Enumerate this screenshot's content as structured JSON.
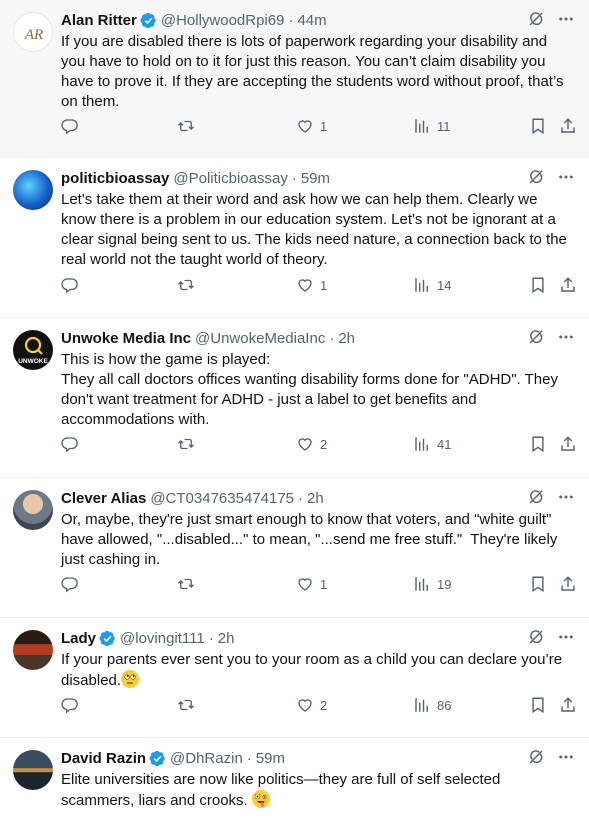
{
  "tweets": [
    {
      "name": "Alan Ritter",
      "verified": true,
      "handle": "@HollywoodRpi69",
      "time": "44m",
      "text": "If you are disabled there is lots of paperwork regarding your disability and you have to hold on to it for just this reason. You can’t claim disability you have to prove it. If they are accepting the students word without proof, that’s on them.",
      "likes": "1",
      "views": "11"
    },
    {
      "name": "politicbioassay",
      "verified": false,
      "handle": "@Politicbioassay",
      "time": "59m",
      "text": "Let's take them at their word and ask how we can help them. Clearly we know there is a problem in our education system. Let's not be ignorant at a clear signal being sent to us. The kids need nature, a connection back to the real world not the taught world of theory.",
      "likes": "1",
      "views": "14"
    },
    {
      "name": "Unwoke Media Inc",
      "verified": false,
      "handle": "@UnwokeMediaInc",
      "time": "2h",
      "text": "This is how the game is played:\nThey all call doctors offices wanting disability forms done for \"ADHD\". They don't want treatment for ADHD - just a label to get benefits and accommodations with.",
      "avatar_text": "UNWOKE",
      "likes": "2",
      "views": "41"
    },
    {
      "name": "Clever Alias",
      "verified": false,
      "handle": "@CT0347635474175",
      "time": "2h",
      "text": "Or, maybe, they're just smart enough to know that voters, and \"white guilt\" have allowed, \"...disabled...\" to mean, \"...send me free stuff.\"  They're likely just cashing in.",
      "likes": "1",
      "views": "19"
    },
    {
      "name": "Lady",
      "verified": true,
      "handle": "@lovingit111",
      "time": "2h",
      "text": "If your parents ever sent you to your room as a child you can declare you’re disabled.",
      "emoji": "face-with-rolling-eyes",
      "likes": "2",
      "views": "86"
    },
    {
      "name": "David Razin",
      "verified": true,
      "handle": "@DhRazin",
      "time": "59m",
      "text": "Elite universities are now like politics—they are full of self selected scammers, liars and crooks.",
      "emoji": "zany-face"
    }
  ],
  "icons": {
    "verified": "verified-badge-icon",
    "grok": "grok-icon",
    "more": "more-icon",
    "reply": "reply-icon",
    "retweet": "retweet-icon",
    "like": "heart-icon",
    "views": "views-icon",
    "bookmark": "bookmark-icon",
    "share": "share-icon"
  },
  "colors": {
    "verified": "#1d9bf0",
    "secondary_text": "#536471",
    "highlight_bg": "#f7f7f7"
  }
}
